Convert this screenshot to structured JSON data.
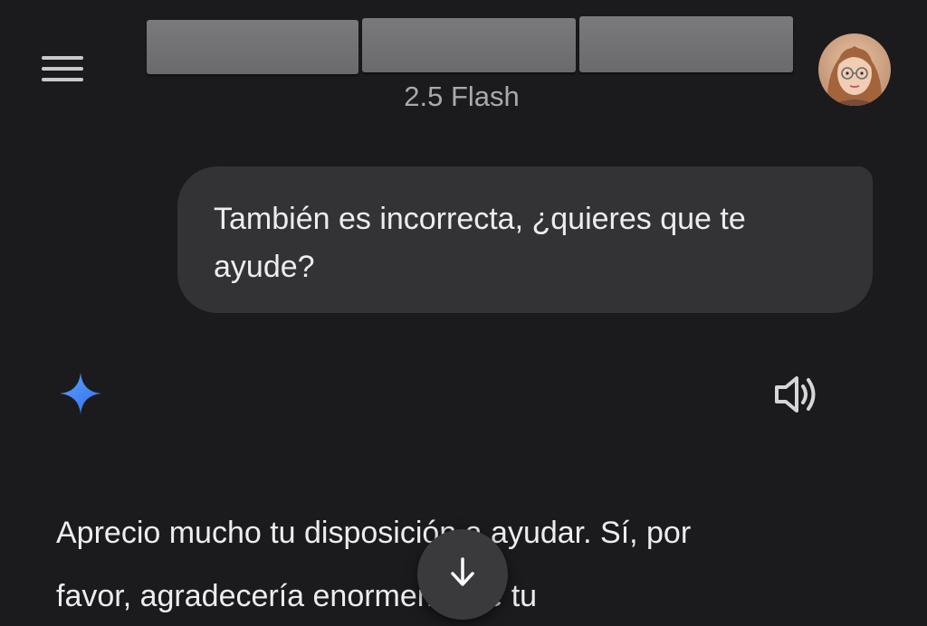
{
  "header": {
    "title": "",
    "model_label": "2.5 Flash",
    "menu_icon": "menu-icon",
    "avatar_icon": "user-avatar"
  },
  "conversation": {
    "user_message": "También es incorrecta, ¿quieres que te ayude?",
    "assistant_icon": "gemini-spark-icon",
    "speaker_icon": "speaker-icon",
    "assistant_reply_line1": "Aprecio mucho tu disposición a ayudar. Sí, por",
    "assistant_reply_line2": "favor, agradecería enormemente tu"
  },
  "controls": {
    "scroll_down_icon": "arrow-down-icon"
  },
  "colors": {
    "background": "#1b1b1d",
    "bubble": "#333336",
    "accent_blue": "#4a8cff",
    "muted_text": "#a9a9ad"
  }
}
